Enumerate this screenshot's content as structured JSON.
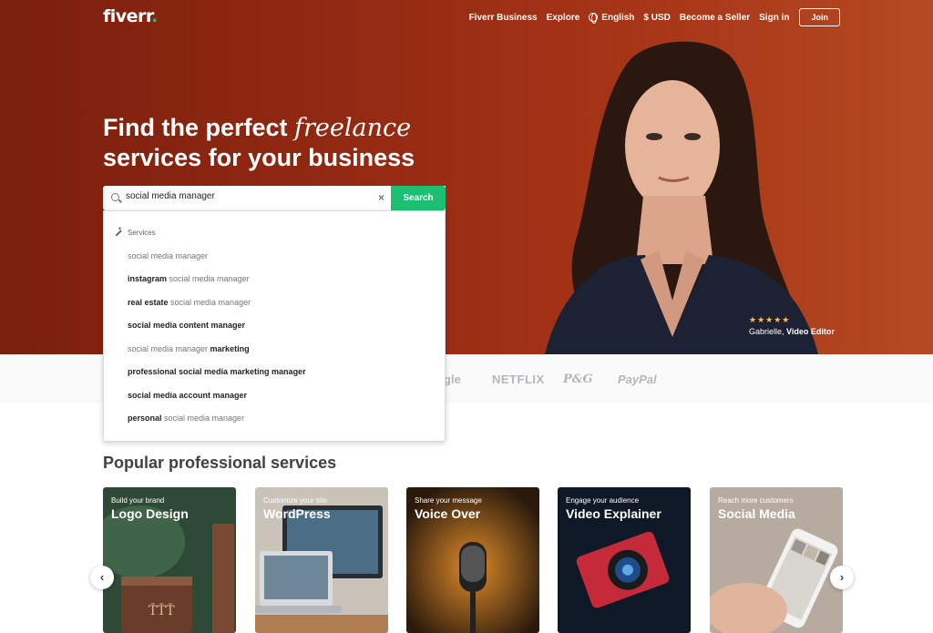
{
  "nav": {
    "logo": "fiverr",
    "logo_dot": ".",
    "links": [
      "Fiverr Business",
      "Explore",
      "English",
      "$ USD",
      "Become a Seller",
      "Sign in"
    ],
    "join": "Join"
  },
  "hero": {
    "headline_part1": "Find the perfect ",
    "headline_italic": "freelance",
    "headline_line2": "services for your business",
    "rating_stars": "★★★★★",
    "caption_name": "Gabrielle,",
    "caption_role": "Video Editor"
  },
  "search": {
    "value": "social media manager",
    "button": "Search"
  },
  "dropdown": {
    "section": "Services",
    "suggestions": [
      {
        "pre": "",
        "mid": "social media manager",
        "post": ""
      },
      {
        "pre": "instagram",
        "mid": " social media manager",
        "post": ""
      },
      {
        "pre": "real estate",
        "mid": " social media manager",
        "post": ""
      },
      {
        "pre": "social media content manager",
        "mid": "",
        "post": ""
      },
      {
        "pre": "",
        "mid": "social media manager ",
        "post": "marketing"
      },
      {
        "pre": "professional social media marketing manager",
        "mid": "",
        "post": ""
      },
      {
        "pre": "social media account manager",
        "mid": "",
        "post": ""
      },
      {
        "pre": "personal",
        "mid": " social media manager",
        "post": ""
      }
    ]
  },
  "trusted": {
    "brands": [
      "gle",
      "NETFLIX",
      "P&G",
      "PayPal"
    ]
  },
  "popular": {
    "title": "Popular professional services",
    "cards": [
      {
        "sub": "Build your brand",
        "title": "Logo Design",
        "color": "#2e4a36"
      },
      {
        "sub": "Customize your site",
        "title": "WordPress",
        "color": "#8a8f96"
      },
      {
        "sub": "Share your message",
        "title": "Voice Over",
        "color": "#5a3a1c"
      },
      {
        "sub": "Engage your audience",
        "title": "Video Explainer",
        "color": "#0f1826"
      },
      {
        "sub": "Reach more customers",
        "title": "Social Media",
        "color": "#b7aba0"
      }
    ]
  },
  "colors": {
    "hero": "#952a12",
    "accent": "#1dbf73"
  }
}
